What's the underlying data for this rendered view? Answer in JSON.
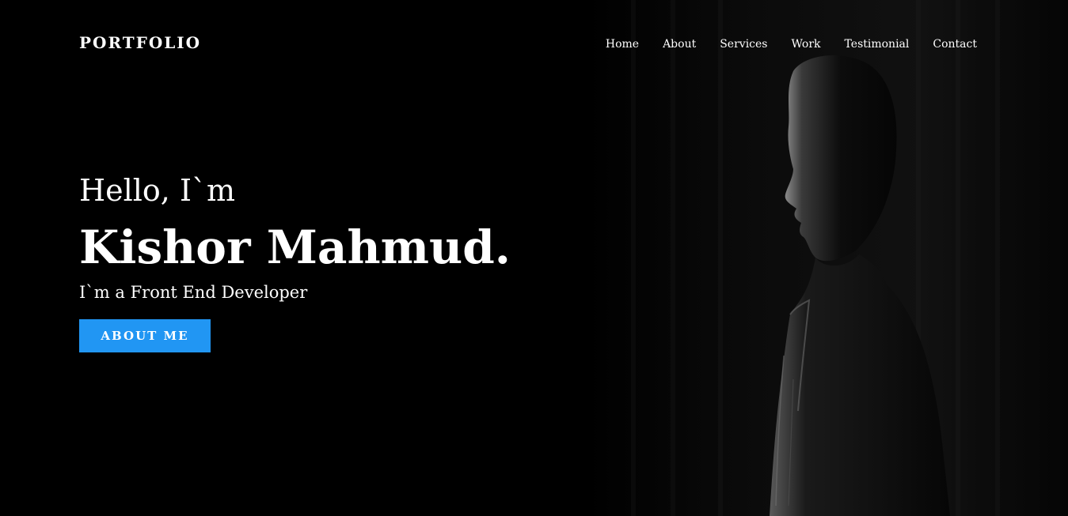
{
  "header": {
    "logo": "PORTFOLIO",
    "nav": [
      {
        "label": "Home"
      },
      {
        "label": "About"
      },
      {
        "label": "Services"
      },
      {
        "label": "Work"
      },
      {
        "label": "Testimonial"
      },
      {
        "label": "Contact"
      }
    ]
  },
  "hero": {
    "greeting": "Hello, I`m",
    "name": "Kishor Mahmud.",
    "role": "I`m a Front End Developer",
    "button_label": "ABOUT ME",
    "photo_icon": "person-silhouette-profile-icon"
  },
  "colors": {
    "background": "#000000",
    "accent": "#2196f3",
    "text": "#ffffff"
  }
}
